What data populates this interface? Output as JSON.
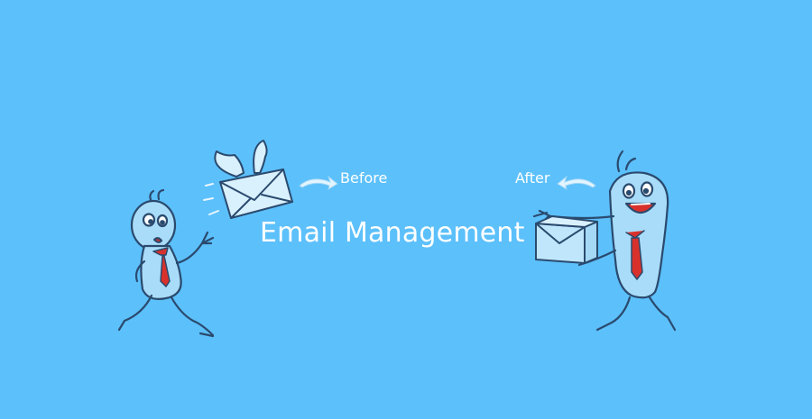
{
  "banner": {
    "title": "Email Management",
    "before_label": "Before",
    "after_label": "After"
  },
  "colors": {
    "background": "#5cc0fb",
    "figure_fill": "#a9dcf8",
    "outline": "#2a4a6e",
    "tie": "#d8312b",
    "text": "#ffffff"
  },
  "icons": {
    "left_figure": "stressed-stick-figure-icon",
    "right_figure": "smiling-stick-figure-icon",
    "flying_envelope": "winged-envelope-icon",
    "box": "package-box-icon",
    "before_arrow": "curved-arrow-right-icon",
    "after_arrow": "curved-arrow-left-icon"
  }
}
